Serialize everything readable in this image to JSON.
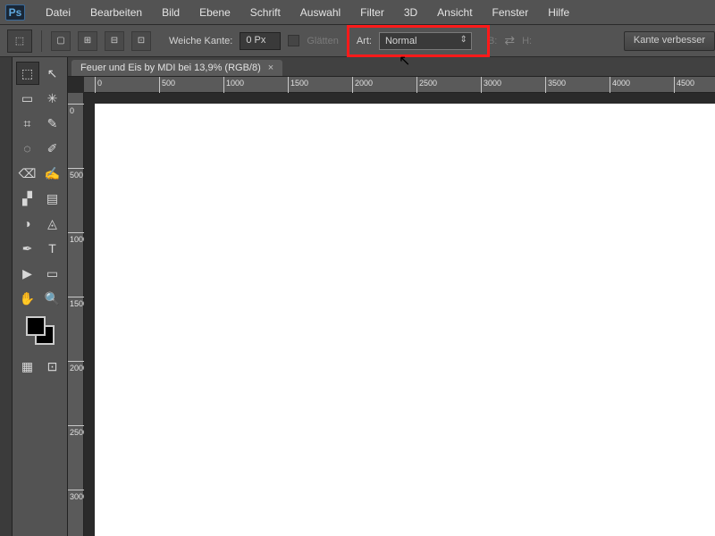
{
  "menu": {
    "logo": "Ps",
    "items": [
      "Datei",
      "Bearbeiten",
      "Bild",
      "Ebene",
      "Schrift",
      "Auswahl",
      "Filter",
      "3D",
      "Ansicht",
      "Fenster",
      "Hilfe"
    ]
  },
  "options": {
    "feather_label": "Weiche Kante:",
    "feather_value": "0 Px",
    "antialias_label": "Glätten",
    "style_label": "Art:",
    "style_value": "Normal",
    "width_label": "B:",
    "height_label": "H:",
    "refine_label": "Kante verbesser"
  },
  "tab": {
    "title": "Feuer und Eis by MDI bei 13,9% (RGB/8)",
    "close": "×"
  },
  "ruler": {
    "h_ticks": [
      {
        "pos": 0,
        "label": "0"
      },
      {
        "pos": 72,
        "label": "500"
      },
      {
        "pos": 144,
        "label": "1000"
      },
      {
        "pos": 216,
        "label": "1500"
      },
      {
        "pos": 288,
        "label": "2000"
      },
      {
        "pos": 360,
        "label": "2500"
      },
      {
        "pos": 432,
        "label": "3000"
      },
      {
        "pos": 504,
        "label": "3500"
      },
      {
        "pos": 576,
        "label": "4000"
      },
      {
        "pos": 648,
        "label": "4500"
      }
    ],
    "v_ticks": [
      {
        "pos": 0,
        "label": "0"
      },
      {
        "pos": 72,
        "label": "500"
      },
      {
        "pos": 144,
        "label": "1000"
      },
      {
        "pos": 216,
        "label": "1500"
      },
      {
        "pos": 288,
        "label": "2000"
      },
      {
        "pos": 360,
        "label": "2500"
      },
      {
        "pos": 432,
        "label": "3000"
      }
    ]
  },
  "tools": {
    "rows": [
      [
        "⬚",
        "↖"
      ],
      [
        "▭",
        "✳"
      ],
      [
        "⌗",
        "✎"
      ],
      [
        "◌",
        "✐"
      ],
      [
        "⌫",
        "✍"
      ],
      [
        "▞",
        "▤"
      ],
      [
        "◑",
        "◬"
      ],
      [
        "✒",
        "T"
      ],
      [
        "▶",
        "▭"
      ],
      [
        "✋",
        "🔍"
      ]
    ],
    "bottom": [
      "▦",
      "⊡"
    ]
  }
}
